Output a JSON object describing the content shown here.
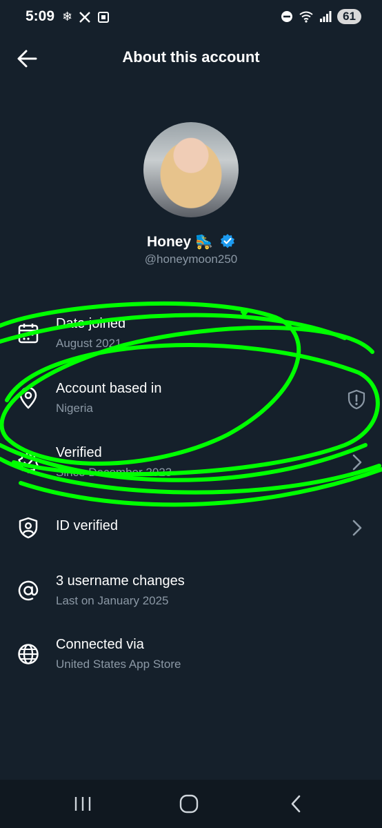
{
  "status_bar": {
    "time": "5:09",
    "battery": "61",
    "icons_left": [
      "snowflake-icon",
      "x-logo-icon",
      "screenshot-icon"
    ],
    "icons_right": [
      "dnd-icon",
      "wifi-icon",
      "signal-icon"
    ]
  },
  "header": {
    "title": "About this account"
  },
  "profile": {
    "name": "Honey 🛼",
    "handle": "@honeymoon250",
    "verified_color": "#1d9bf0"
  },
  "items": [
    {
      "label": "Date joined",
      "sub": "August 2021",
      "icon": "calendar-icon"
    },
    {
      "label": "Account based in",
      "sub": "Nigeria",
      "icon": "location-pin-icon",
      "trailing_icon": "shield-alert-icon"
    },
    {
      "label": "Verified",
      "sub": "Since December 2023",
      "icon": "verified-badge-icon",
      "trailing_icon": "chevron-right-icon"
    },
    {
      "label": "ID verified",
      "sub": "",
      "icon": "id-shield-icon",
      "trailing_icon": "chevron-right-icon"
    },
    {
      "label": "3 username changes",
      "sub": "Last on January 2025",
      "icon": "at-sign-icon"
    },
    {
      "label": "Connected via",
      "sub": "United States App Store",
      "icon": "globe-icon"
    }
  ],
  "colors": {
    "background": "#15202b",
    "secondary_text": "#8b98a5",
    "scribble": "#00ff00"
  },
  "nav": [
    "recent-apps-icon",
    "home-icon",
    "back-nav-icon"
  ]
}
